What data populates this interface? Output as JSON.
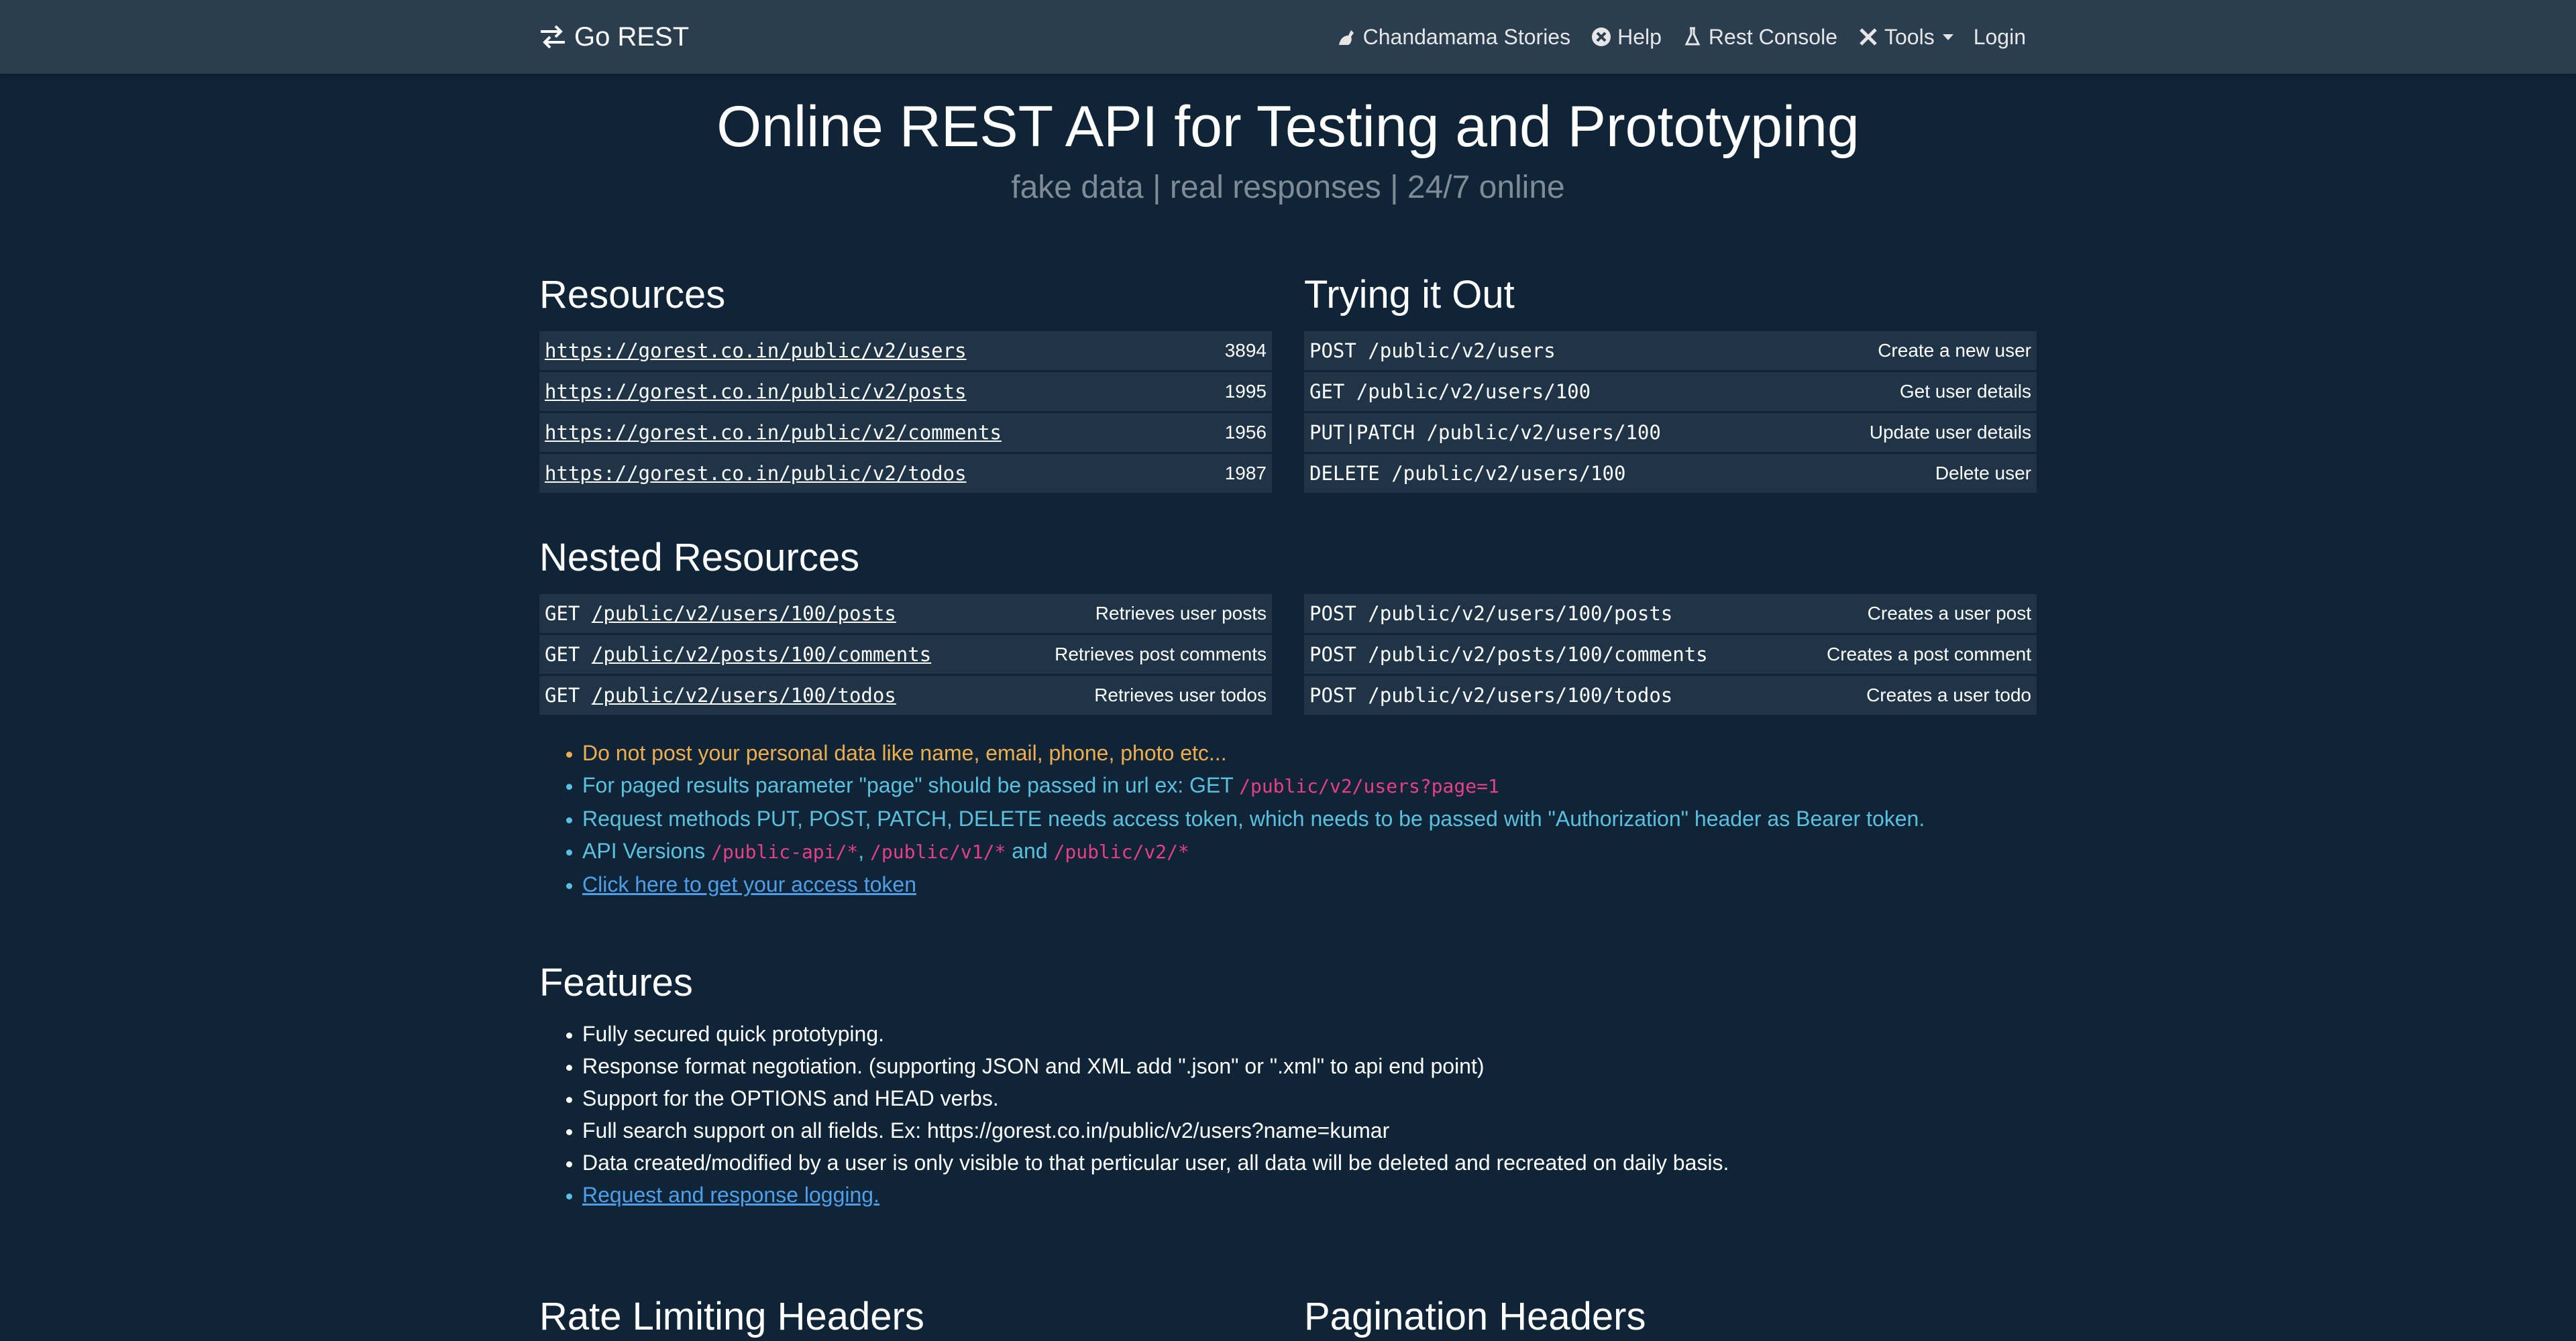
{
  "nav": {
    "brand": "Go REST",
    "links": [
      {
        "label": "Chandamama Stories",
        "icon": "story-icon"
      },
      {
        "label": "Help",
        "icon": "help-icon"
      },
      {
        "label": "Rest Console",
        "icon": "flask-icon"
      },
      {
        "label": "Tools",
        "icon": "tools-icon"
      },
      {
        "label": "Login",
        "icon": ""
      }
    ]
  },
  "hero": {
    "title": "Online REST API for Testing and Prototyping",
    "subtitle": "fake data | real responses | 24/7 online"
  },
  "resources": {
    "heading": "Resources",
    "rows": [
      {
        "url": "https://gorest.co.in/public/v2/users",
        "count": "3894"
      },
      {
        "url": "https://gorest.co.in/public/v2/posts",
        "count": "1995"
      },
      {
        "url": "https://gorest.co.in/public/v2/comments",
        "count": "1956"
      },
      {
        "url": "https://gorest.co.in/public/v2/todos",
        "count": "1987"
      }
    ]
  },
  "trying": {
    "heading": "Trying it Out",
    "rows": [
      {
        "req": "POST /public/v2/users",
        "desc": "Create a new user"
      },
      {
        "req": "GET /public/v2/users/100",
        "desc": "Get user details"
      },
      {
        "req": "PUT|PATCH /public/v2/users/100",
        "desc": "Update user details"
      },
      {
        "req": "DELETE /public/v2/users/100",
        "desc": "Delete user"
      }
    ]
  },
  "nested": {
    "heading": "Nested Resources",
    "left": [
      {
        "method": "GET",
        "path": "/public/v2/users/100/posts",
        "desc": "Retrieves user posts"
      },
      {
        "method": "GET",
        "path": "/public/v2/posts/100/comments",
        "desc": "Retrieves post comments"
      },
      {
        "method": "GET",
        "path": "/public/v2/users/100/todos",
        "desc": "Retrieves user todos"
      }
    ],
    "right": [
      {
        "req": "POST /public/v2/users/100/posts",
        "desc": "Creates a user post"
      },
      {
        "req": "POST /public/v2/posts/100/comments",
        "desc": "Creates a post comment"
      },
      {
        "req": "POST /public/v2/users/100/todos",
        "desc": "Creates a user todo"
      }
    ]
  },
  "notes": {
    "warning": "Do not post your personal data like name, email, phone, photo etc...",
    "paged_text": "For paged results parameter \"page\" should be passed in url ex: GET ",
    "paged_code": "/public/v2/users?page=1",
    "auth": "Request methods PUT, POST, PATCH, DELETE needs access token, which needs to be passed with \"Authorization\" header as Bearer token.",
    "versions_text": "API Versions ",
    "v_api": "/public-api/*",
    "comma": ", ",
    "v1": "/public/v1/*",
    "and": " and ",
    "v2": "/public/v2/*",
    "token_link": "Click here to get your access token"
  },
  "features": {
    "heading": "Features",
    "items": [
      "Fully secured quick prototyping.",
      "Response format negotiation. (supporting JSON and XML add \".json\" or \".xml\" to api end point)",
      "Support for the OPTIONS and HEAD verbs.",
      "Full search support on all fields. Ex: https://gorest.co.in/public/v2/users?name=kumar",
      "Data created/modified by a user is only visible to that perticular user, all data will be deleted and recreated on daily basis."
    ],
    "logging_link": "Request and response logging."
  },
  "bottom": {
    "rate_heading": "Rate Limiting Headers",
    "pagination_heading": "Pagination Headers"
  },
  "colors": {
    "background": "#0f2537",
    "navbar": "#2b3e50",
    "row": "#1f3446",
    "warning": "#f0ad4e",
    "info": "#5bc0de",
    "code": "#e83e8c",
    "link": "#4f9ee8"
  }
}
